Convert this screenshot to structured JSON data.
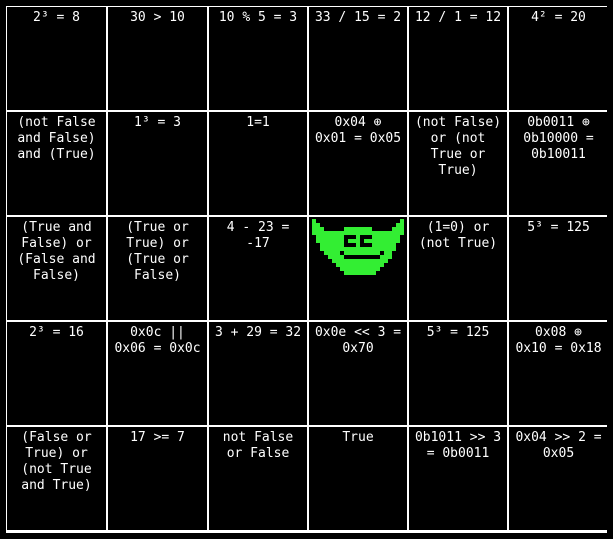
{
  "colors": {
    "background": "#000000",
    "grid_line": "#ffffff",
    "text": "#ffffff",
    "mascot_green": "#33ee33",
    "mascot_dark": "#000000"
  },
  "board": {
    "rows": [
      [
        "2³ = 8",
        "30 > 10",
        "10 % 5 = 3",
        "33 / 15 = 2",
        "12 / 1 = 12",
        "4² = 20"
      ],
      [
        "(not False\nand False)\nand (True)",
        "1³ = 3",
        "1=1",
        "0x04 ⊕\n0x01 = 0x05",
        "(not False)\nor (not\nTrue or\nTrue)",
        "0b0011 ⊕\n0b10000 =\n0b10011"
      ],
      [
        "(True and\nFalse) or\n(False and\nFalse)",
        "(True or\nTrue) or\n(True or\nFalse)",
        "4 - 23 =\n-17",
        "",
        "(1=0) or\n(not True)",
        "5³ = 125"
      ],
      [
        "2³ = 16",
        "0x0c ||\n0x06 = 0x0c",
        "3 + 29 = 32",
        "0x0e << 3 =\n0x70",
        "5³ = 125",
        "0x08 ⊕\n0x10 = 0x18"
      ],
      [
        "(False or\nTrue) or\n(not True\nand True)",
        "17 >= 7",
        "not False\nor False",
        "True",
        "0b1011 >> 3\n= 0b0011",
        "0x04 >> 2 =\n0x05"
      ]
    ],
    "free_space": {
      "row": 2,
      "col": 3,
      "icon": "green-monster-icon"
    }
  }
}
